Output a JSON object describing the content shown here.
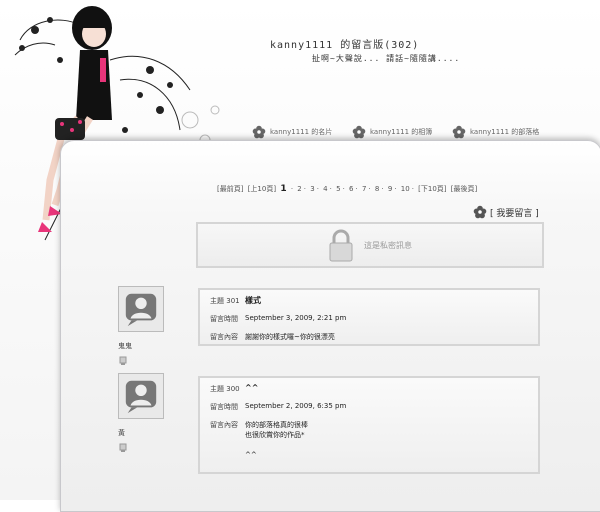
{
  "header": {
    "title": "kanny1111 的留言版(302)",
    "subtitle": "扯啊~大聲說... 請話~隨隨講...."
  },
  "nav": {
    "items": [
      {
        "label": "kanny1111 的名片"
      },
      {
        "label": "kanny1111 的相簿"
      },
      {
        "label": "kanny1111 的部落格"
      }
    ]
  },
  "pager": {
    "first": "[最前頁]",
    "prev10": "[上10頁]",
    "current": "1",
    "pages": [
      "2",
      "3",
      "4",
      "5",
      "6",
      "7",
      "8",
      "9",
      "10"
    ],
    "next10": "[下10頁]",
    "last": "[最後頁]"
  },
  "leave_message": "[ 我要留言 ]",
  "private_notice": "這是私密訊息",
  "labels": {
    "subject": "主題",
    "time": "留言時間",
    "content": "留言內容"
  },
  "messages": [
    {
      "author": "鬼鬼",
      "number": "301",
      "subject": "樣式",
      "time": "September 3, 2009, 2:21 pm",
      "content": [
        "謝謝你的樣式囉~你的很漂亮"
      ]
    },
    {
      "author": "黃",
      "number": "300",
      "subject": "^^",
      "time": "September 2, 2009, 6:35 pm",
      "content": [
        "你的部落格真的很棒",
        "也很欣賞你的作品*",
        "",
        "^^"
      ]
    }
  ]
}
